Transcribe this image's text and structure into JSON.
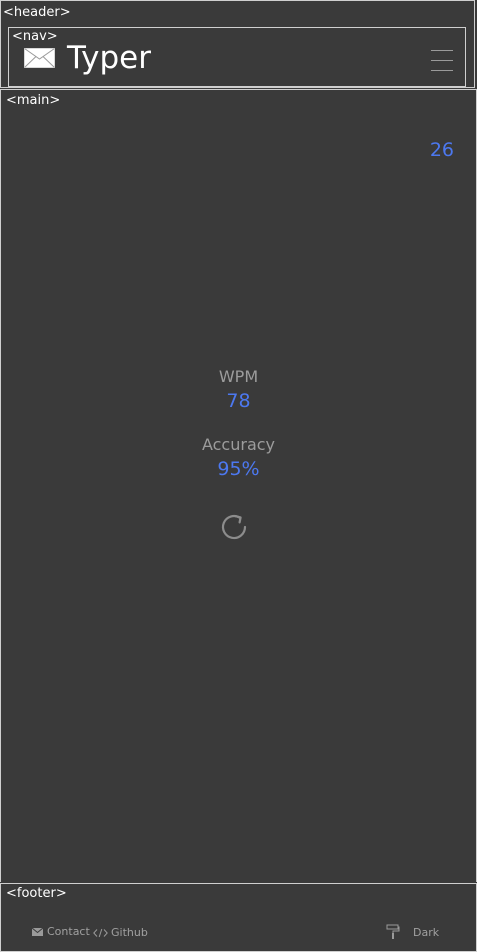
{
  "header": {
    "tag": "<header>",
    "nav": {
      "tag": "<nav>",
      "logo_icon": "envelope-icon",
      "title": "Typer",
      "menu_icon": "hamburger-menu-icon"
    }
  },
  "main": {
    "tag": "<main>",
    "timer": "26",
    "stats": {
      "wpm_label": "WPM",
      "wpm_value": "78",
      "accuracy_label": "Accuracy",
      "accuracy_value": "95%"
    },
    "restart_icon": "restart-icon"
  },
  "footer": {
    "tag": "<footer>",
    "contact_label": "Contact",
    "github_label": "Github",
    "theme_label": "Dark"
  },
  "colors": {
    "background": "#3a3a3a",
    "accent": "#4c78f0",
    "muted_text": "#9c9c9c",
    "border": "#cfcfcf"
  }
}
